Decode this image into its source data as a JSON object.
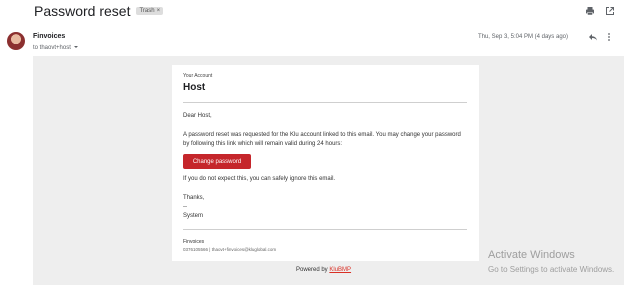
{
  "email": {
    "subject": "Password reset",
    "label_chip": "Trash",
    "label_chip_close": "×",
    "sender_name": "Finvoices",
    "recipient_line": "to thaovt+host",
    "date": "Thu, Sep 3, 5:04 PM (4 days ago)"
  },
  "icons": {
    "print": "print-icon",
    "open_new_window": "open-in-new-window-icon",
    "reply": "reply-icon",
    "more": "more-vert-icon",
    "dropdown": "chevron-down-icon"
  },
  "body": {
    "small_label": "Your Account",
    "heading": "Host",
    "greeting": "Dear Host,",
    "paragraph": "A password reset was requested for the Klu account linked to this email. You may change your password by following this link which will remain valid during 24 hours:",
    "button_label": "Change password",
    "ignore_text": "If you do not expect this, you can safely ignore this email.",
    "thanks": "Thanks,",
    "dash": "--",
    "signature": "System",
    "footer_name": "Finvoices",
    "footer_contact": "0376105566 | thaovt+finvoices@kluglobal.com"
  },
  "powered_by": {
    "prefix": "Powered by ",
    "link": "KluBMP"
  },
  "overlay": {
    "activate_title": "Activate Windows",
    "activate_sub": "Go to Settings to activate Windows."
  },
  "colors": {
    "button": "#c5262b",
    "link": "#d93025",
    "background_gray": "#eeeeee"
  }
}
